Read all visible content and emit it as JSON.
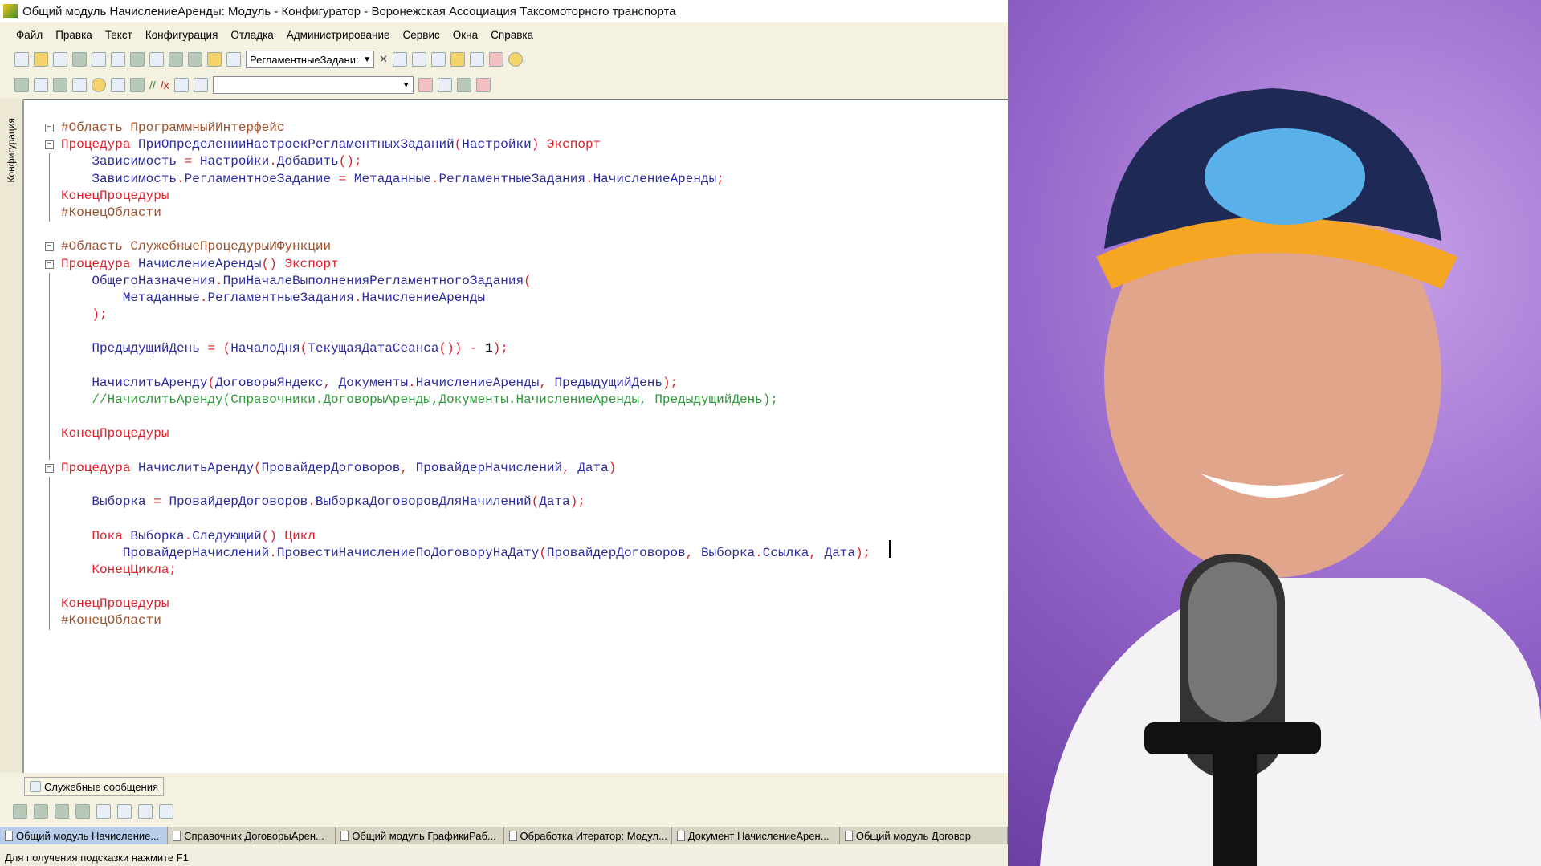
{
  "window": {
    "title": "Общий модуль НачислениеАренды: Модуль - Конфигуратор - Воронежская Ассоциация Таксомоторного транспорта"
  },
  "menu": [
    "Файл",
    "Правка",
    "Текст",
    "Конфигурация",
    "Отладка",
    "Администрирование",
    "Сервис",
    "Окна",
    "Справка"
  ],
  "toolbar": {
    "search_value": "РегламентныеЗадани:",
    "search2_value": ""
  },
  "sidepanel": {
    "label": "Конфигурация"
  },
  "code": [
    {
      "fold": "box",
      "t": [
        [
          "#Область ",
          "rg"
        ],
        [
          "ПрограммныйИнтерфейс",
          "rg"
        ]
      ]
    },
    {
      "fold": "box",
      "t": [
        [
          "Процедура ",
          "kw"
        ],
        [
          "ПриОпределенииНастроекРегламентныхЗаданий",
          "id"
        ],
        [
          "(",
          "pn"
        ],
        [
          "Настройки",
          "id"
        ],
        [
          ")",
          "pn"
        ],
        [
          " Экспорт",
          "kw"
        ]
      ]
    },
    {
      "fold": "line",
      "t": [
        [
          "    Зависимость",
          "id"
        ],
        [
          " = ",
          "pn"
        ],
        [
          "Настройки",
          "id"
        ],
        [
          ".",
          "pn"
        ],
        [
          "Добавить",
          "id"
        ],
        [
          "();",
          "pn"
        ]
      ]
    },
    {
      "fold": "line",
      "t": [
        [
          "    Зависимость",
          "id"
        ],
        [
          ".",
          "pn"
        ],
        [
          "РегламентноеЗадание",
          "id"
        ],
        [
          " = ",
          "pn"
        ],
        [
          "Метаданные",
          "id"
        ],
        [
          ".",
          "pn"
        ],
        [
          "РегламентныеЗадания",
          "id"
        ],
        [
          ".",
          "pn"
        ],
        [
          "НачислениеАренды",
          "id"
        ],
        [
          ";",
          "pn"
        ]
      ]
    },
    {
      "fold": "line",
      "t": [
        [
          "КонецПроцедуры",
          "kw"
        ]
      ]
    },
    {
      "fold": "line",
      "t": [
        [
          "#КонецОбласти",
          "rg"
        ]
      ]
    },
    {
      "fold": "",
      "t": []
    },
    {
      "fold": "box",
      "t": [
        [
          "#Область ",
          "rg"
        ],
        [
          "СлужебныеПроцедурыИФункции",
          "rg"
        ]
      ]
    },
    {
      "fold": "box",
      "t": [
        [
          "Процедура ",
          "kw"
        ],
        [
          "НачислениеАренды",
          "id"
        ],
        [
          "()",
          "pn"
        ],
        [
          " Экспорт",
          "kw"
        ]
      ]
    },
    {
      "fold": "line",
      "t": [
        [
          "    ОбщегоНазначения",
          "id"
        ],
        [
          ".",
          "pn"
        ],
        [
          "ПриНачалеВыполненияРегламентногоЗадания",
          "id"
        ],
        [
          "(",
          "pn"
        ]
      ]
    },
    {
      "fold": "line",
      "t": [
        [
          "        Метаданные",
          "id"
        ],
        [
          ".",
          "pn"
        ],
        [
          "РегламентныеЗадания",
          "id"
        ],
        [
          ".",
          "pn"
        ],
        [
          "НачислениеАренды",
          "id"
        ]
      ]
    },
    {
      "fold": "line",
      "t": [
        [
          "    );",
          "pn"
        ]
      ]
    },
    {
      "fold": "line",
      "t": []
    },
    {
      "fold": "line",
      "t": [
        [
          "    ПредыдущийДень",
          "id"
        ],
        [
          " = (",
          "pn"
        ],
        [
          "НачалоДня",
          "id"
        ],
        [
          "(",
          "pn"
        ],
        [
          "ТекущаяДатаСеанса",
          "id"
        ],
        [
          "()) - ",
          "pn"
        ],
        [
          "1",
          "nm"
        ],
        [
          ");",
          "pn"
        ]
      ]
    },
    {
      "fold": "line",
      "t": []
    },
    {
      "fold": "line",
      "t": [
        [
          "    НачислитьАренду",
          "id"
        ],
        [
          "(",
          "pn"
        ],
        [
          "ДоговорыЯндекс",
          "id"
        ],
        [
          ", ",
          "pn"
        ],
        [
          "Документы",
          "id"
        ],
        [
          ".",
          "pn"
        ],
        [
          "НачислениеАренды",
          "id"
        ],
        [
          ", ",
          "pn"
        ],
        [
          "ПредыдущийДень",
          "id"
        ],
        [
          ");",
          "pn"
        ]
      ]
    },
    {
      "fold": "line",
      "t": [
        [
          "    //НачислитьАренду(Справочники.ДоговорыАренды,Документы.НачислениеАренды, ПредыдущийДень);",
          "cm"
        ]
      ]
    },
    {
      "fold": "line",
      "t": []
    },
    {
      "fold": "line",
      "t": [
        [
          "КонецПроцедуры",
          "kw"
        ]
      ]
    },
    {
      "fold": "line",
      "t": []
    },
    {
      "fold": "box",
      "t": [
        [
          "Процедура ",
          "kw"
        ],
        [
          "НачислитьАренду",
          "id"
        ],
        [
          "(",
          "pn"
        ],
        [
          "ПровайдерДоговоров",
          "id"
        ],
        [
          ", ",
          "pn"
        ],
        [
          "ПровайдерНачислений",
          "id"
        ],
        [
          ", ",
          "pn"
        ],
        [
          "Дата",
          "id"
        ],
        [
          ")",
          "pn"
        ]
      ]
    },
    {
      "fold": "line",
      "t": []
    },
    {
      "fold": "line",
      "t": [
        [
          "    Выборка",
          "id"
        ],
        [
          " = ",
          "pn"
        ],
        [
          "ПровайдерДоговоров",
          "id"
        ],
        [
          ".",
          "pn"
        ],
        [
          "ВыборкаДоговоровДляНачилений",
          "id"
        ],
        [
          "(",
          "pn"
        ],
        [
          "Дата",
          "id"
        ],
        [
          ");",
          "pn"
        ]
      ]
    },
    {
      "fold": "line",
      "t": []
    },
    {
      "fold": "line",
      "t": [
        [
          "    Пока ",
          "kw"
        ],
        [
          "Выборка",
          "id"
        ],
        [
          ".",
          "pn"
        ],
        [
          "Следующий",
          "id"
        ],
        [
          "()",
          "pn"
        ],
        [
          " Цикл",
          "kw"
        ]
      ]
    },
    {
      "fold": "line",
      "t": [
        [
          "        ПровайдерНачислений",
          "id"
        ],
        [
          ".",
          "pn"
        ],
        [
          "ПровестиНачислениеПоДоговоруНаДату",
          "id"
        ],
        [
          "(",
          "pn"
        ],
        [
          "ПровайдерДоговоров",
          "id"
        ],
        [
          ", ",
          "pn"
        ],
        [
          "Выборка",
          "id"
        ],
        [
          ".",
          "pn"
        ],
        [
          "Ссылка",
          "id"
        ],
        [
          ", ",
          "pn"
        ],
        [
          "Дата",
          "id"
        ],
        [
          ");",
          "pn"
        ]
      ]
    },
    {
      "fold": "line",
      "t": [
        [
          "    КонецЦикла;",
          "kw"
        ]
      ]
    },
    {
      "fold": "line",
      "t": []
    },
    {
      "fold": "line",
      "t": [
        [
          "КонецПроцедуры",
          "kw"
        ]
      ]
    },
    {
      "fold": "line",
      "t": [
        [
          "#КонецОбласти",
          "rg"
        ]
      ]
    }
  ],
  "messages_tab": "Служебные сообщения",
  "tabs": [
    "Общий модуль Начисление...",
    "Справочник ДоговорыАрен...",
    "Общий модуль ГрафикиРаб...",
    "Обработка Итератор: Модул...",
    "Документ НачислениеАрен...",
    "Общий модуль Договор"
  ],
  "status": "Для получения подсказки нажмите F1"
}
